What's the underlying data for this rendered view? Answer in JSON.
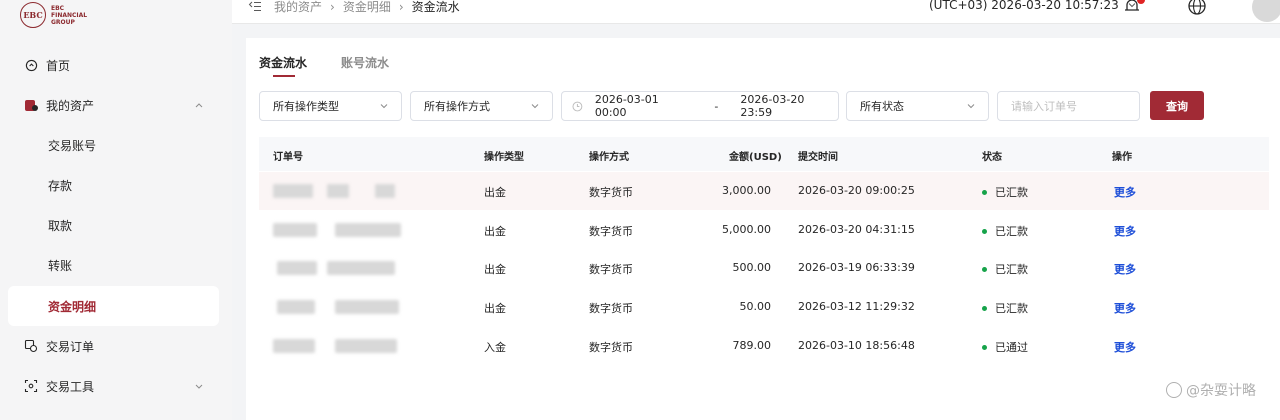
{
  "brand": {
    "logo_mark": "EBC",
    "logo_text_1": "EBC",
    "logo_text_2": "FINANCIAL",
    "logo_text_3": "GROUP",
    "accent": "#a12a35"
  },
  "sidebar": {
    "items": [
      {
        "label": "首页",
        "icon": "home-icon"
      },
      {
        "label": "我的资产",
        "icon": "wallet-icon",
        "expanded": true
      },
      {
        "label": "交易账号"
      },
      {
        "label": "存款"
      },
      {
        "label": "取款"
      },
      {
        "label": "转账"
      },
      {
        "label": "资金明细",
        "active": true
      },
      {
        "label": "交易订单",
        "icon": "orders-icon"
      },
      {
        "label": "交易工具",
        "icon": "tools-icon"
      }
    ]
  },
  "header": {
    "breadcrumb": [
      "我的资产",
      "资金明细",
      "资金流水"
    ],
    "timezone_time": "(UTC+03)  2026-03-20 10:57:23"
  },
  "tabs": [
    {
      "label": "资金流水",
      "active": true
    },
    {
      "label": "账号流水",
      "active": false
    }
  ],
  "filters": {
    "op_type": "所有操作类型",
    "op_method": "所有操作方式",
    "date_start": "2026-03-01 00:00",
    "date_sep": "-",
    "date_end": "2026-03-20 23:59",
    "status": "所有状态",
    "order_placeholder": "请输入订单号",
    "query_button": "查询"
  },
  "table": {
    "columns": [
      "订单号",
      "操作类型",
      "操作方式",
      "金额(USD)",
      "提交时间",
      "状态",
      "操作"
    ],
    "rows": [
      {
        "type": "出金",
        "method": "数字货币",
        "amount": "3,000.00",
        "time": "2026-03-20 09:00:25",
        "status": "已汇款",
        "action": "更多"
      },
      {
        "type": "出金",
        "method": "数字货币",
        "amount": "5,000.00",
        "time": "2026-03-20 04:31:15",
        "status": "已汇款",
        "action": "更多"
      },
      {
        "type": "出金",
        "method": "数字货币",
        "amount": "500.00",
        "time": "2026-03-19 06:33:39",
        "status": "已汇款",
        "action": "更多"
      },
      {
        "type": "出金",
        "method": "数字货币",
        "amount": "50.00",
        "time": "2026-03-12 11:29:32",
        "status": "已汇款",
        "action": "更多"
      },
      {
        "type": "入金",
        "method": "数字货币",
        "amount": "789.00",
        "time": "2026-03-10 18:56:48",
        "status": "已通过",
        "action": "更多"
      }
    ]
  },
  "watermark": "@杂耍计略"
}
